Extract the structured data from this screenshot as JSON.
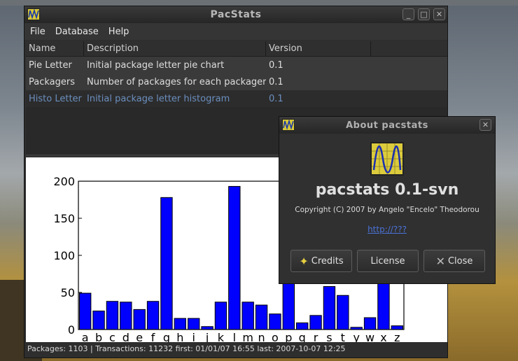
{
  "main_window": {
    "title": "PacStats",
    "menu": [
      "File",
      "Database",
      "Help"
    ],
    "columns": [
      "Name",
      "Description",
      "Version"
    ],
    "rows": [
      {
        "name": "Pie Letter",
        "description": "Initial package letter pie chart",
        "version": "0.1"
      },
      {
        "name": "Packagers",
        "description": "Number of packages for each packager",
        "version": "0.1"
      },
      {
        "name": "Histo Letter",
        "description": "Initial package letter histogram",
        "version": "0.1"
      }
    ],
    "selected_row": 2,
    "status": "Packages: 1103  | Transactions: 11232  first: 01/01/07 16:55   last: 2007-10-07 12:25"
  },
  "window_buttons": {
    "minimize": "_",
    "maximize": "□",
    "close": "✕"
  },
  "chart_data": {
    "type": "bar",
    "categories": [
      "a",
      "b",
      "c",
      "d",
      "e",
      "f",
      "g",
      "h",
      "i",
      "j",
      "k",
      "l",
      "m",
      "n",
      "o",
      "p",
      "q",
      "r",
      "s",
      "t",
      "y",
      "w",
      "x",
      "z"
    ],
    "values": [
      49,
      25,
      38,
      37,
      27,
      38,
      178,
      15,
      15,
      4,
      37,
      193,
      37,
      33,
      21,
      62,
      9,
      19,
      58,
      46,
      3,
      16,
      62,
      5
    ],
    "yticks": [
      "0",
      "50",
      "100",
      "150",
      "200"
    ],
    "ylim": [
      0,
      200
    ],
    "bar_color": "#0000ff"
  },
  "about": {
    "title": "About pacstats",
    "app_name": "pacstats 0.1-svn",
    "copyright": "Copyright (C) 2007 by Angelo \"Encelo\" Theodorou",
    "link": "http://???",
    "credits_label": "Credits",
    "license_label": "License",
    "close_label": "Close"
  }
}
